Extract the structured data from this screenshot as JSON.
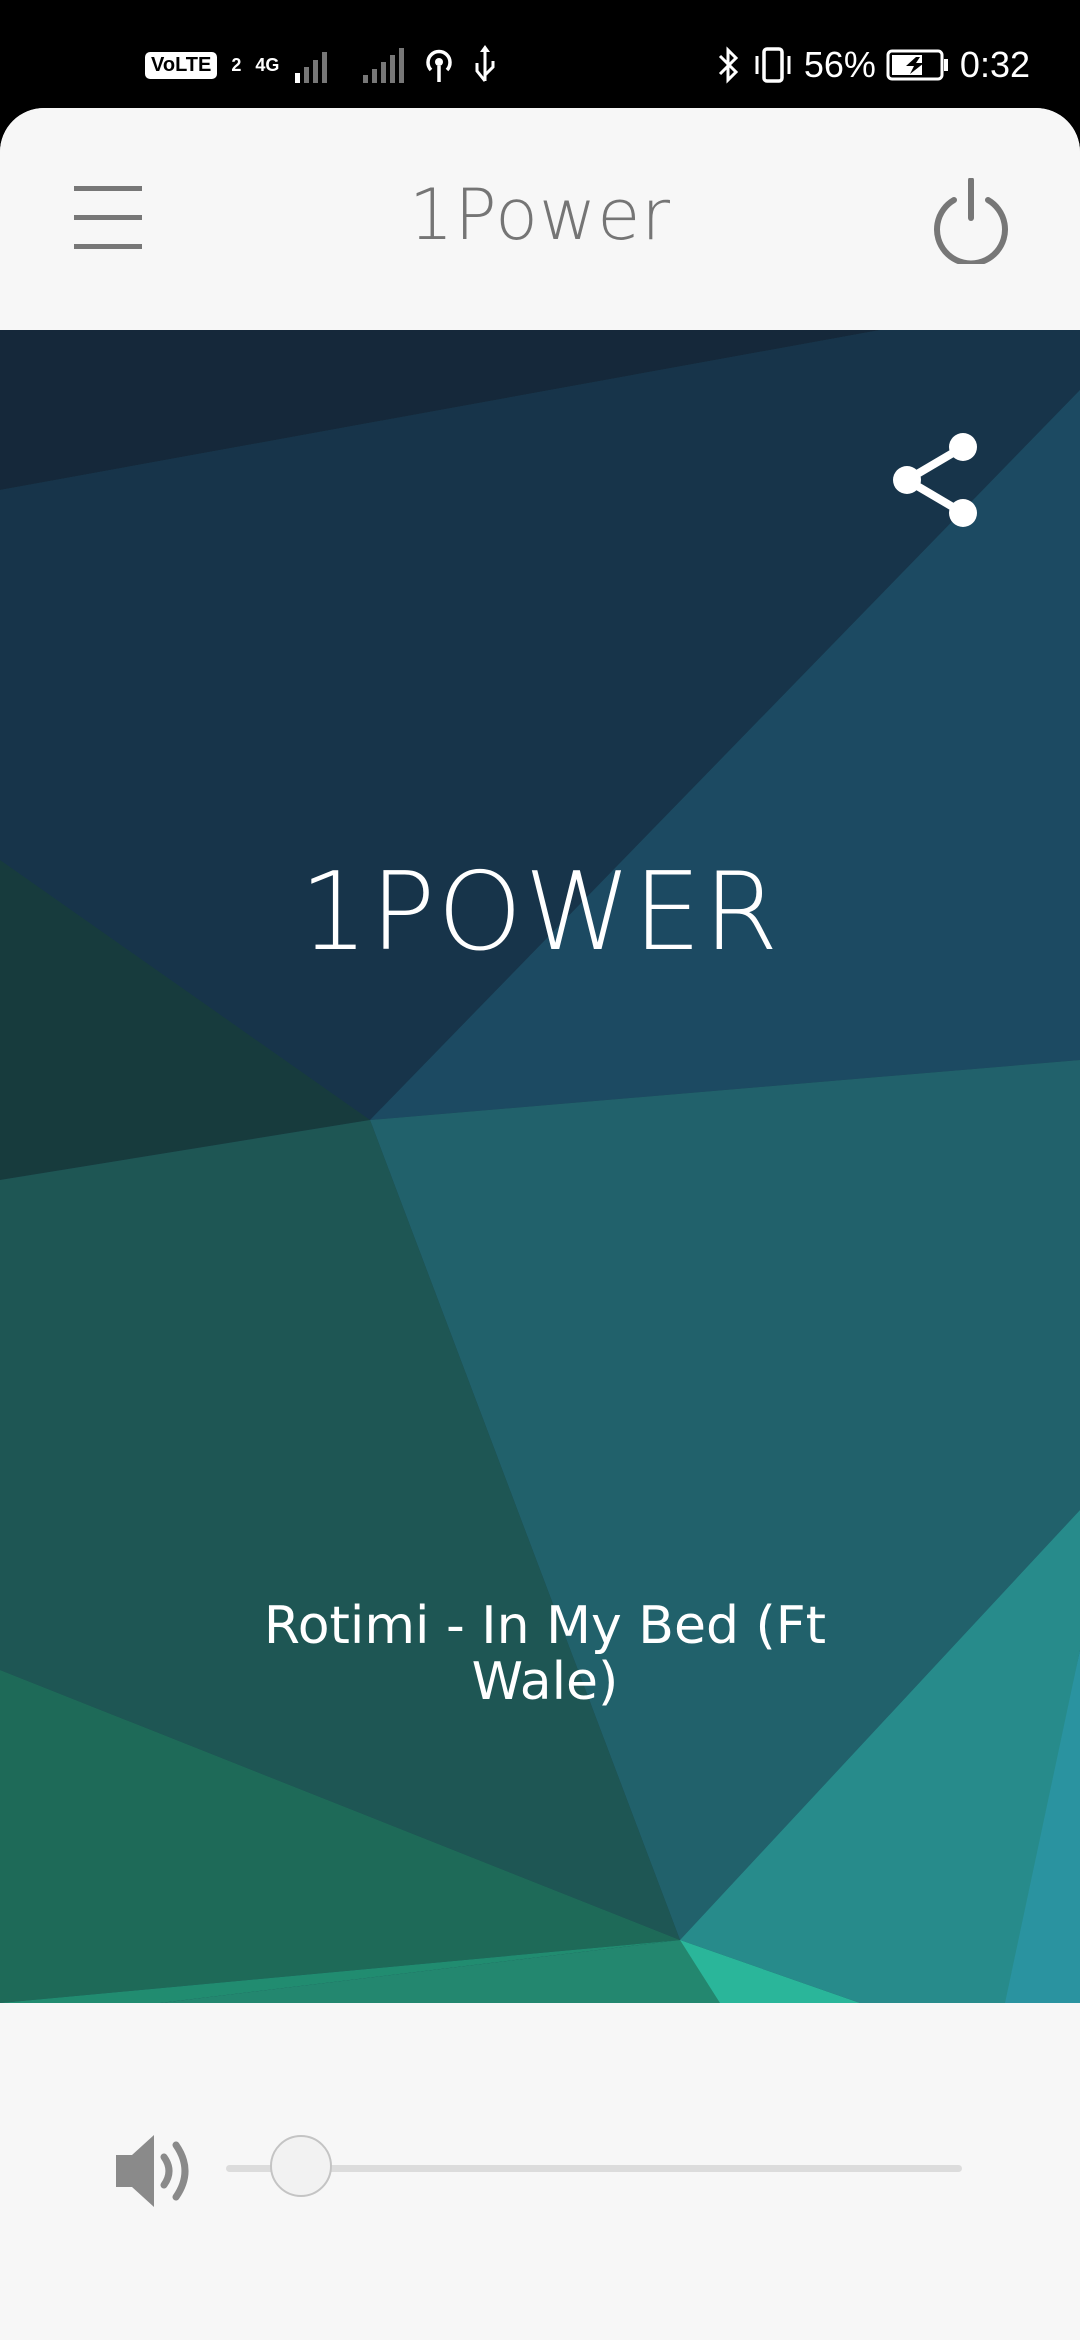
{
  "status_bar": {
    "volte_label": "VoLTE",
    "sim_slot": "2",
    "network_type": "4G",
    "battery_percent": "56%",
    "time": "0:32",
    "icons": [
      "volte-icon",
      "signal-icon",
      "signal-icon",
      "hotspot-icon",
      "usb-icon",
      "bluetooth-icon",
      "vibrate-icon",
      "battery-charging-icon"
    ]
  },
  "header": {
    "title": "1Power",
    "menu_icon": "hamburger-menu-icon",
    "power_icon": "power-icon"
  },
  "player": {
    "station_name": "1POWER",
    "track_title": "Rotimi - In My Bed (Ft Wale)",
    "share_icon": "share-icon"
  },
  "volume": {
    "icon": "speaker-icon",
    "level": 0.035
  },
  "colors": {
    "app_background": "#f7f7f7",
    "title_gray": "#757575",
    "hero_dark": "#17303f",
    "hero_teal": "#27908c",
    "hero_green": "#1f6a5a"
  }
}
